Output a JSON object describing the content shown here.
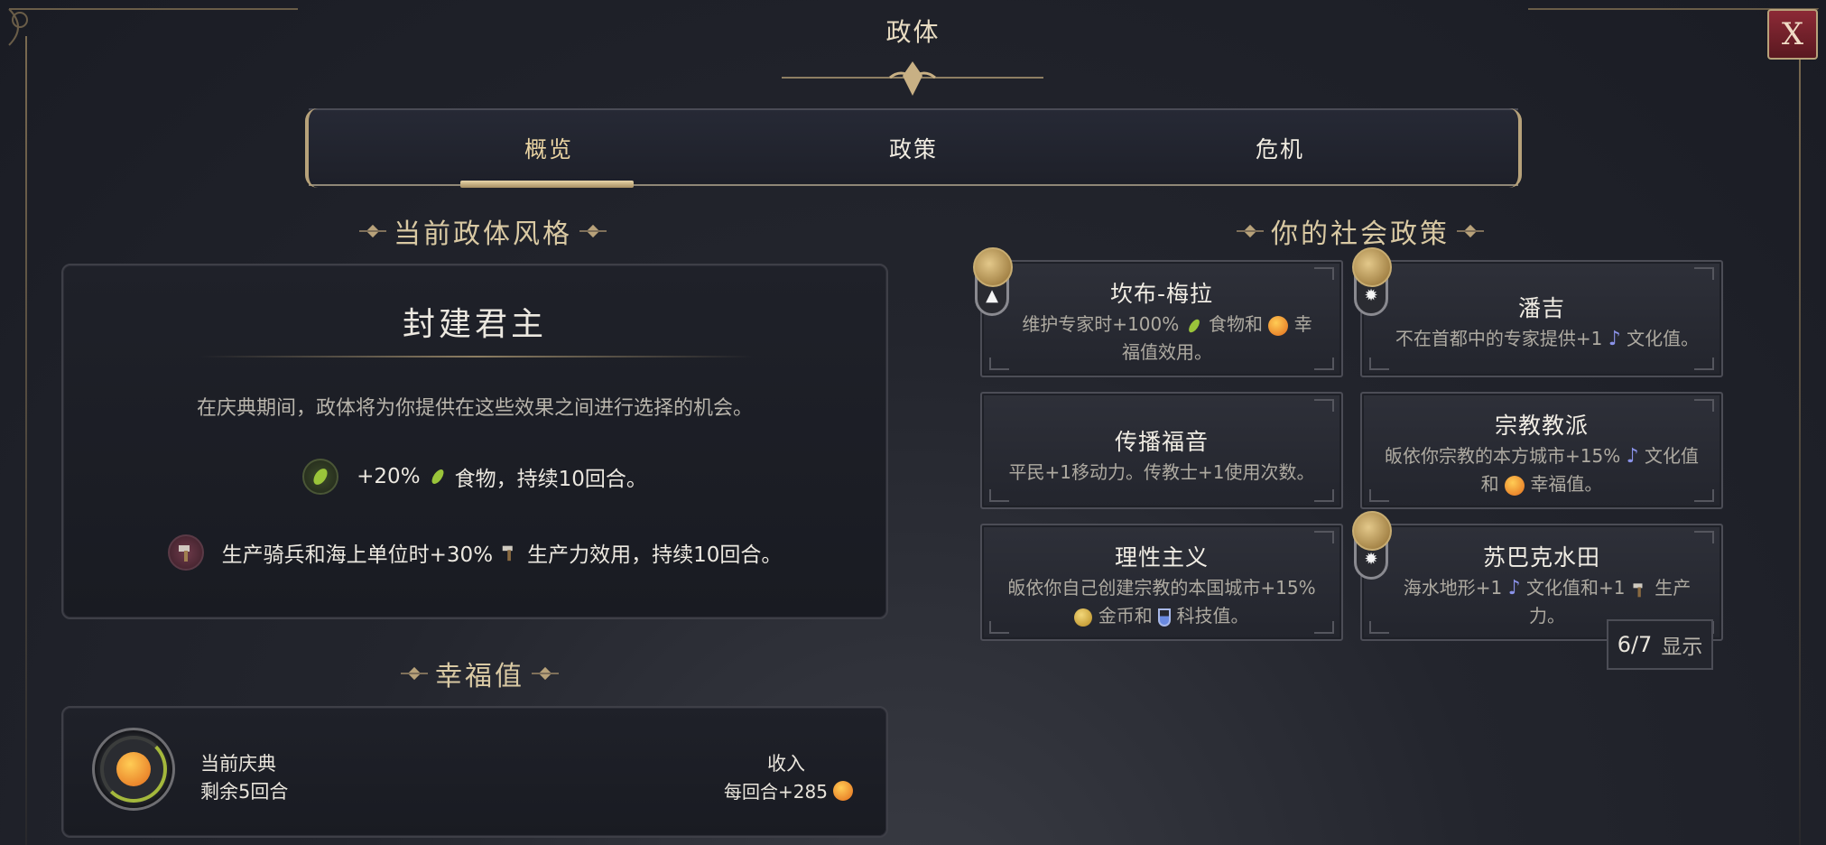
{
  "window": {
    "title": "政体",
    "close_label": "X"
  },
  "tabs": [
    {
      "label": "概览",
      "active": true
    },
    {
      "label": "政策",
      "active": false
    },
    {
      "label": "危机",
      "active": false
    }
  ],
  "government": {
    "section_title": "当前政体风格",
    "name": "封建君主",
    "description": "在庆典期间，政体将为你提供在这些效果之间进行选择的机会。",
    "effects": [
      {
        "icon": "food-icon",
        "prefix": "+20%",
        "suffix": "食物，持续10回合。"
      },
      {
        "icon": "production-icon",
        "prefix": "生产骑兵和海上单位时+30%",
        "suffix": "生产力效用，持续10回合。"
      }
    ]
  },
  "happiness": {
    "section_title": "幸福值",
    "celebration_label": "当前庆典",
    "celebration_remaining": "剩余5回合",
    "income_label": "收入",
    "income_value": "每回合+285"
  },
  "social_policies": {
    "section_title": "你的社会政策",
    "cards": [
      {
        "name": "坎布-梅拉",
        "desc_a": "维护专家时+100%",
        "desc_b": "食物和",
        "desc_c": "幸福值效用。",
        "badge": "flame-icon"
      },
      {
        "name": "潘吉",
        "desc_a": "不在首都中的专家提供+1",
        "desc_b": "文化值。",
        "badge": "sun-icon"
      },
      {
        "name": "传播福音",
        "desc_a": "平民+1移动力。传教士+1使用次数。"
      },
      {
        "name": "宗教教派",
        "desc_a": "皈依你宗教的本方城市+15%",
        "desc_b": "文化值和",
        "desc_c": "幸福值。"
      },
      {
        "name": "理性主义",
        "desc_a": "皈依你自己创建宗教的本国城市+15%",
        "desc_b": "金币和",
        "desc_c": "科技值。"
      },
      {
        "name": "苏巴克水田",
        "desc_a": "海水地形+1",
        "desc_b": "文化值和+1",
        "desc_c": "生产力。",
        "badge": "sun-icon"
      }
    ],
    "counter": {
      "value": "6/7",
      "label": "显示"
    }
  },
  "colors": {
    "accent_gold": "#b8a27a",
    "close_red": "#8c2a36",
    "background": "#1f2129"
  }
}
